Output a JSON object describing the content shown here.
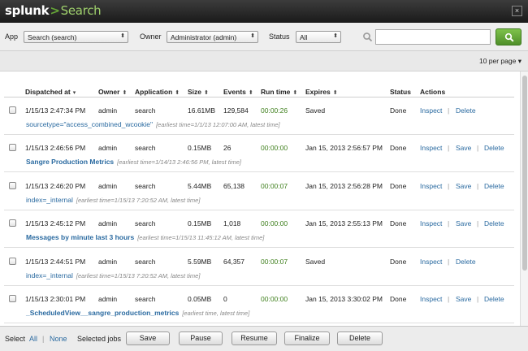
{
  "titlebar": {
    "brand": "splunk",
    "separator": ">",
    "app": "Search",
    "close_glyph": "×"
  },
  "filters": {
    "app_label": "App",
    "app_value": "Search (search)",
    "owner_label": "Owner",
    "owner_value": "Administrator (admin)",
    "status_label": "Status",
    "status_value": "All",
    "search_value": "",
    "search_icon": "magnifier-icon",
    "search_button_icon": "search-icon"
  },
  "pagination": {
    "per_page": "10 per page"
  },
  "columns": {
    "dispatched": "Dispatched at",
    "owner": "Owner",
    "application": "Application",
    "size": "Size",
    "events": "Events",
    "runtime": "Run time",
    "expires": "Expires",
    "status": "Status",
    "actions": "Actions"
  },
  "jobs": [
    {
      "dispatched": "1/15/13 2:47:34 PM",
      "owner": "admin",
      "app": "search",
      "size": "16.61MB",
      "events": "129,584",
      "runtime": "00:00:26",
      "expires": "Saved",
      "status": "Done",
      "inspect": "Inspect",
      "save": "",
      "delete": "Delete",
      "query": "sourcetype=\"access_combined_wcookie\"",
      "query_bold": false,
      "time_range": "[earliest time=1/1/13 12:07:00 AM, latest time]"
    },
    {
      "dispatched": "1/15/13 2:46:56 PM",
      "owner": "admin",
      "app": "search",
      "size": "0.15MB",
      "events": "26",
      "runtime": "00:00:00",
      "expires": "Jan 15, 2013 2:56:57 PM",
      "status": "Done",
      "inspect": "Inspect",
      "save": "Save",
      "delete": "Delete",
      "query": "Sangre Production Metrics",
      "query_bold": true,
      "time_range": "[earliest time=1/14/13 2:46:56 PM, latest time]"
    },
    {
      "dispatched": "1/15/13 2:46:20 PM",
      "owner": "admin",
      "app": "search",
      "size": "5.44MB",
      "events": "65,138",
      "runtime": "00:00:07",
      "expires": "Jan 15, 2013 2:56:28 PM",
      "status": "Done",
      "inspect": "Inspect",
      "save": "Save",
      "delete": "Delete",
      "query": "index=_internal",
      "query_bold": false,
      "time_range": "[earliest time=1/15/13 7:20:52 AM, latest time]"
    },
    {
      "dispatched": "1/15/13 2:45:12 PM",
      "owner": "admin",
      "app": "search",
      "size": "0.15MB",
      "events": "1,018",
      "runtime": "00:00:00",
      "expires": "Jan 15, 2013 2:55:13 PM",
      "status": "Done",
      "inspect": "Inspect",
      "save": "Save",
      "delete": "Delete",
      "query": "Messages by minute last 3 hours",
      "query_bold": true,
      "time_range": "[earliest time=1/15/13 11:45:12 AM, latest time]"
    },
    {
      "dispatched": "1/15/13 2:44:51 PM",
      "owner": "admin",
      "app": "search",
      "size": "5.59MB",
      "events": "64,357",
      "runtime": "00:00:07",
      "expires": "Saved",
      "status": "Done",
      "inspect": "Inspect",
      "save": "",
      "delete": "Delete",
      "query": "index=_internal",
      "query_bold": false,
      "time_range": "[earliest time=1/15/13 7:20:52 AM, latest time]"
    },
    {
      "dispatched": "1/15/13 2:30:01 PM",
      "owner": "admin",
      "app": "search",
      "size": "0.05MB",
      "events": "0",
      "runtime": "00:00:00",
      "expires": "Jan 15, 2013 3:30:02 PM",
      "status": "Done",
      "inspect": "Inspect",
      "save": "Save",
      "delete": "Delete",
      "query": "_ScheduledView__sangre_production_metrics",
      "query_bold": true,
      "time_range": "[earliest time, latest time]"
    }
  ],
  "bottom": {
    "select_label": "Select",
    "all_link": "All",
    "separator": "|",
    "none_link": "None",
    "selected_jobs_label": "Selected jobs",
    "save": "Save",
    "pause": "Pause",
    "resume": "Resume",
    "finalize": "Finalize",
    "delete": "Delete"
  },
  "colors": {
    "accent_green": "#65a637",
    "link_blue": "#2a6aa0",
    "runtime_green": "#3e7f1c"
  }
}
